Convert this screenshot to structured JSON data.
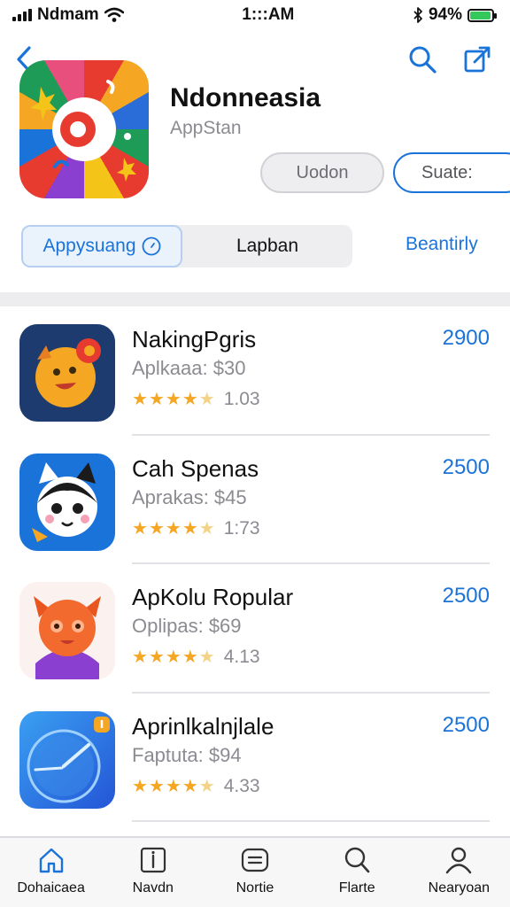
{
  "status_bar": {
    "carrier": "Ndmam",
    "time": "1:::AM",
    "battery_percent": "94%",
    "battery_level": 0.94
  },
  "header": {
    "title": "Ndonneasia",
    "subtitle": "AppStan",
    "update_label": "Uodon",
    "state_label": "Suate:"
  },
  "segments": {
    "active_label": "Appysuang",
    "inactive_label": "Lapban",
    "link_label": "Beantirly"
  },
  "apps": [
    {
      "name": "NakingPgris",
      "subtitle": "Aplkaaa: $30",
      "rating_text": "1.03",
      "stars": 4.5,
      "price": "2900"
    },
    {
      "name": "Cah Spenas",
      "subtitle": "Aprakas: $45",
      "rating_text": "1:73",
      "stars": 4.5,
      "price": "2500"
    },
    {
      "name": "ApKolu Ropular",
      "subtitle": "Oplipas: $69",
      "rating_text": "4.13",
      "stars": 4.5,
      "price": "2500"
    },
    {
      "name": "Aprinlkalnjlale",
      "subtitle": "Faptuta: $94",
      "rating_text": "4.33",
      "stars": 4.5,
      "price": "2500"
    }
  ],
  "tabs": [
    {
      "label": "Dohaicaea",
      "icon": "home-icon"
    },
    {
      "label": "Navdn",
      "icon": "info-icon"
    },
    {
      "label": "Nortie",
      "icon": "list-icon"
    },
    {
      "label": "Flarte",
      "icon": "search-icon"
    },
    {
      "label": "Nearyoan",
      "icon": "person-icon"
    }
  ],
  "colors": {
    "accent": "#1a73d9",
    "star": "#f5a623",
    "battery": "#34c759"
  }
}
